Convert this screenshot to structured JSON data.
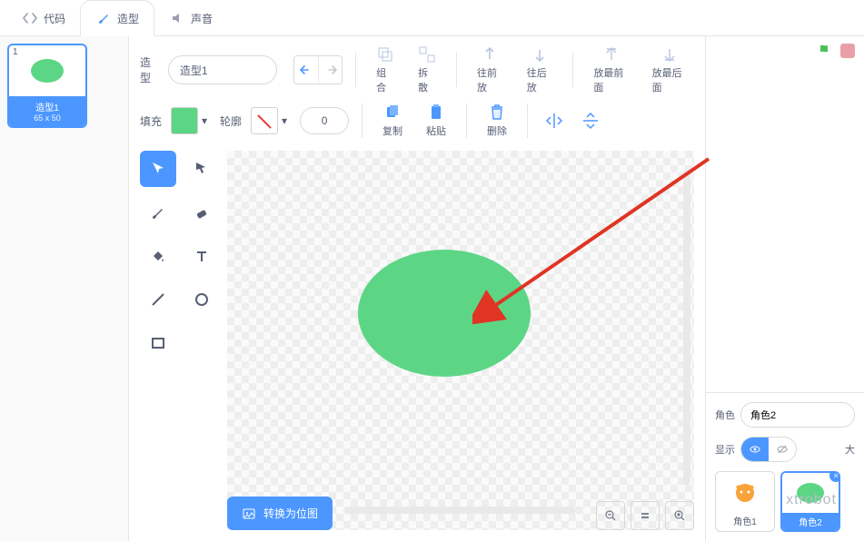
{
  "tabs": {
    "code": "代码",
    "costumes": "造型",
    "sounds": "声音"
  },
  "thumb": {
    "num": "1",
    "name": "造型1",
    "dim": "65 x 50"
  },
  "costume": {
    "label": "造型",
    "name": "造型1"
  },
  "toolbar": {
    "group": "组合",
    "ungroup": "拆散",
    "forward": "往前放",
    "backward": "往后放",
    "front": "放最前面",
    "back": "放最后面",
    "copy": "复制",
    "paste": "粘贴",
    "delete": "删除"
  },
  "fill": {
    "label": "填充",
    "color": "#5cd685"
  },
  "outline": {
    "label": "轮廓",
    "width": "0"
  },
  "convert": "转换为位图",
  "sprite_panel": {
    "sprite_label": "角色",
    "sprite_name": "角色2",
    "show_label": "显示",
    "size_label": "大"
  },
  "sprites": [
    {
      "name": "角色1",
      "selected": false,
      "type": "cat"
    },
    {
      "name": "角色2",
      "selected": true,
      "type": "ellipse"
    }
  ],
  "watermark": "xtrobot"
}
